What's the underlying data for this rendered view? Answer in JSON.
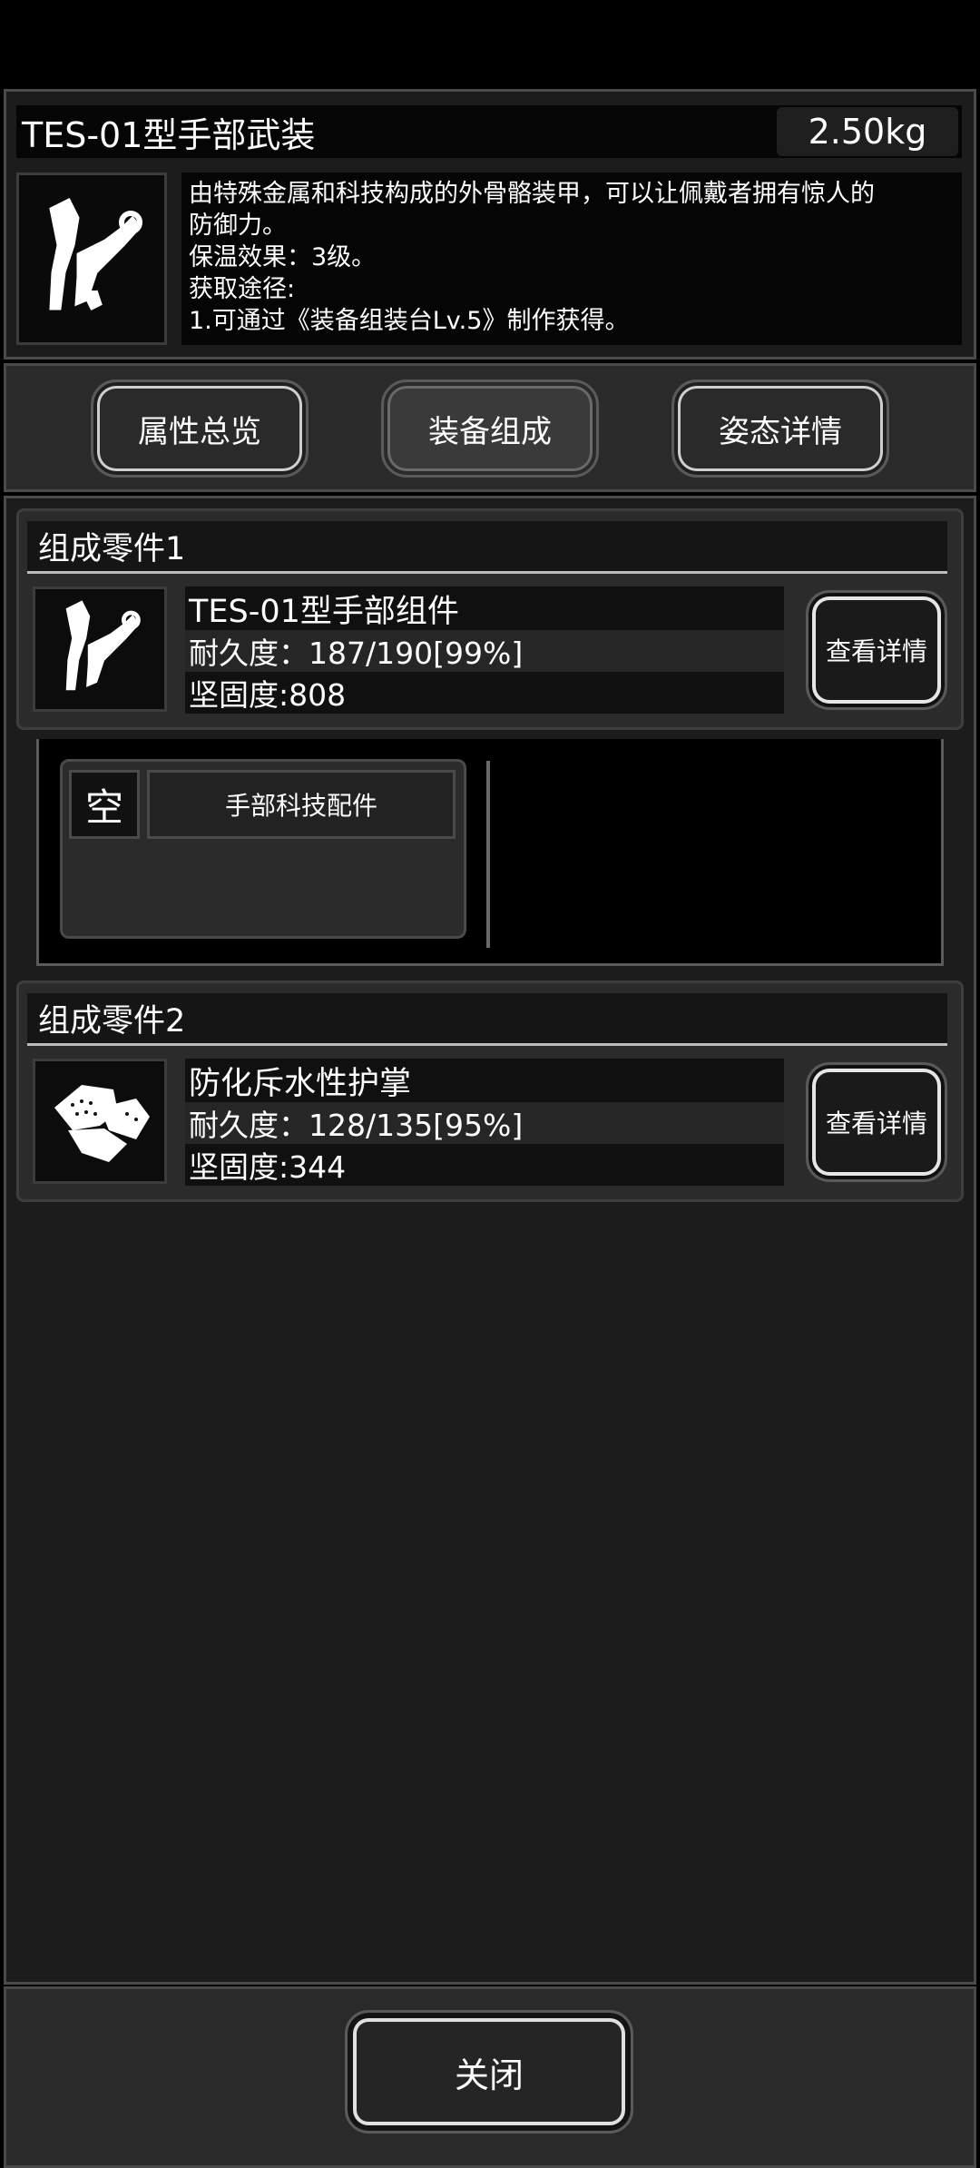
{
  "item": {
    "name": "TES-01型手部武装",
    "weight": "2.50kg",
    "description_lines": [
      "由特殊金属和科技构成的外骨骼装甲，可以让佩戴者拥有惊人的",
      "防御力。",
      "保温效果：3级。",
      "获取途径:",
      "1.可通过《装备组装台Lv.5》制作获得。"
    ]
  },
  "tabs": [
    "属性总览",
    "装备组成",
    "姿态详情"
  ],
  "components": [
    {
      "section_title": "组成零件1",
      "name": "TES-01型手部组件",
      "durability": "耐久度：187/190[99%]",
      "hardness": "坚固度:808",
      "detail_button": "查看详情"
    },
    {
      "section_title": "组成零件2",
      "name": "防化斥水性护掌",
      "durability": "耐久度：128/135[95%]",
      "hardness": "坚固度:344",
      "detail_button": "查看详情"
    }
  ],
  "slot": {
    "status": "空",
    "label": "手部科技配件"
  },
  "close_button": "关闭",
  "icons": [
    "mech-hand-icon",
    "glove-icon"
  ]
}
